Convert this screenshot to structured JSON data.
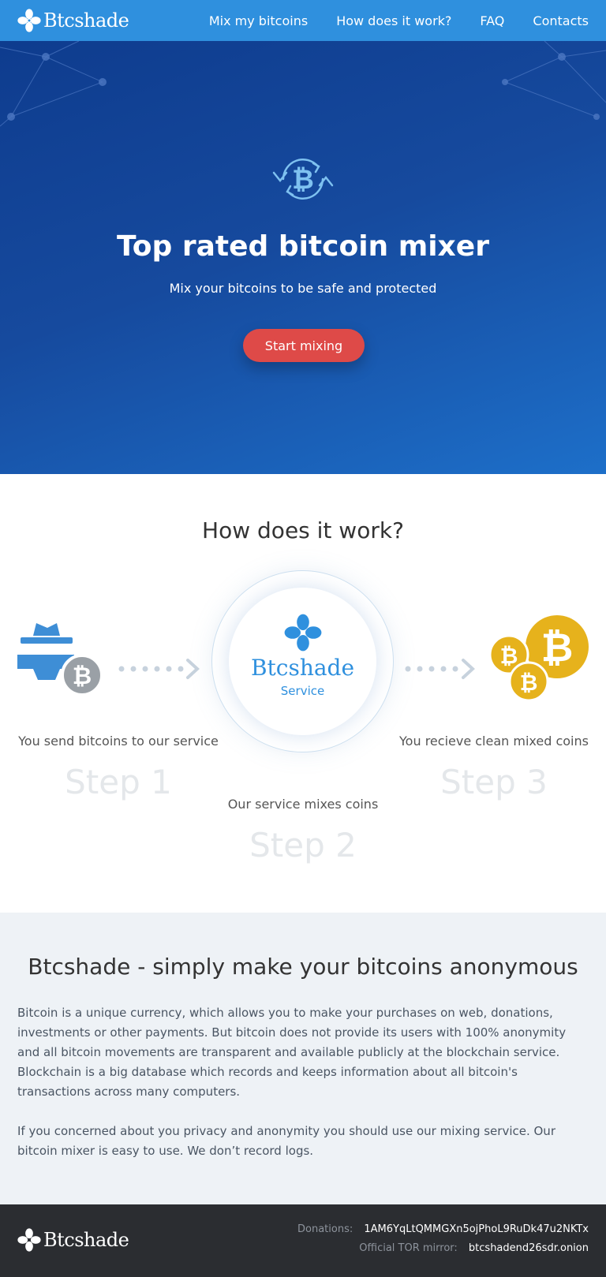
{
  "header": {
    "logo_text": "Btcshade",
    "nav": [
      "Mix my bitcoins",
      "How does it work?",
      "FAQ",
      "Contacts"
    ]
  },
  "hero": {
    "title": "Top rated bitcoin mixer",
    "subtitle": "Mix your bitcoins to be safe and protected",
    "cta_label": "Start mixing",
    "icon": "bitcoin-refresh-icon"
  },
  "how": {
    "title": "How does it work?",
    "center": {
      "name": "Btcshade",
      "label": "Service"
    },
    "steps": [
      {
        "text": "You send bitcoins to our service",
        "label": "Step 1"
      },
      {
        "text": "Our service mixes coins",
        "label": "Step 2"
      },
      {
        "text": "You recieve clean mixed coins",
        "label": "Step 3"
      }
    ]
  },
  "about": {
    "title": "Btcshade - simply make your bitcoins anonymous",
    "para1": "Bitcoin is a unique currency, which allows you to make your purchases on web, donations, investments or other payments. But bitcoin does not provide its users with 100% anonymity and all bitcoin movements are transparent and available publicly at the blockchain service. Blockchain is a big database which records and keeps information about all bitcoin's transactions across many computers.",
    "para2": "If you concerned about you privacy and anonymity you should use our mixing service. Our bitcoin mixer is easy to use. We don’t record logs."
  },
  "footer": {
    "logo_text": "Btcshade",
    "donations_label": "Donations:",
    "donations_value": "1AM6YqLtQMMGXn5ojPhoL9RuDk47u2NKTx",
    "mirror_label": "Official TOR mirror:",
    "mirror_value": "btcshadend26sdr.onion"
  },
  "colors": {
    "header": "#2f90de",
    "hero_dark": "#0d3a8c",
    "hero_light": "#1d6fc9",
    "cta": "#de4a48",
    "coin": "#e6b21c",
    "about_bg": "#eef2f6",
    "footer_bg": "#2b2d31"
  }
}
